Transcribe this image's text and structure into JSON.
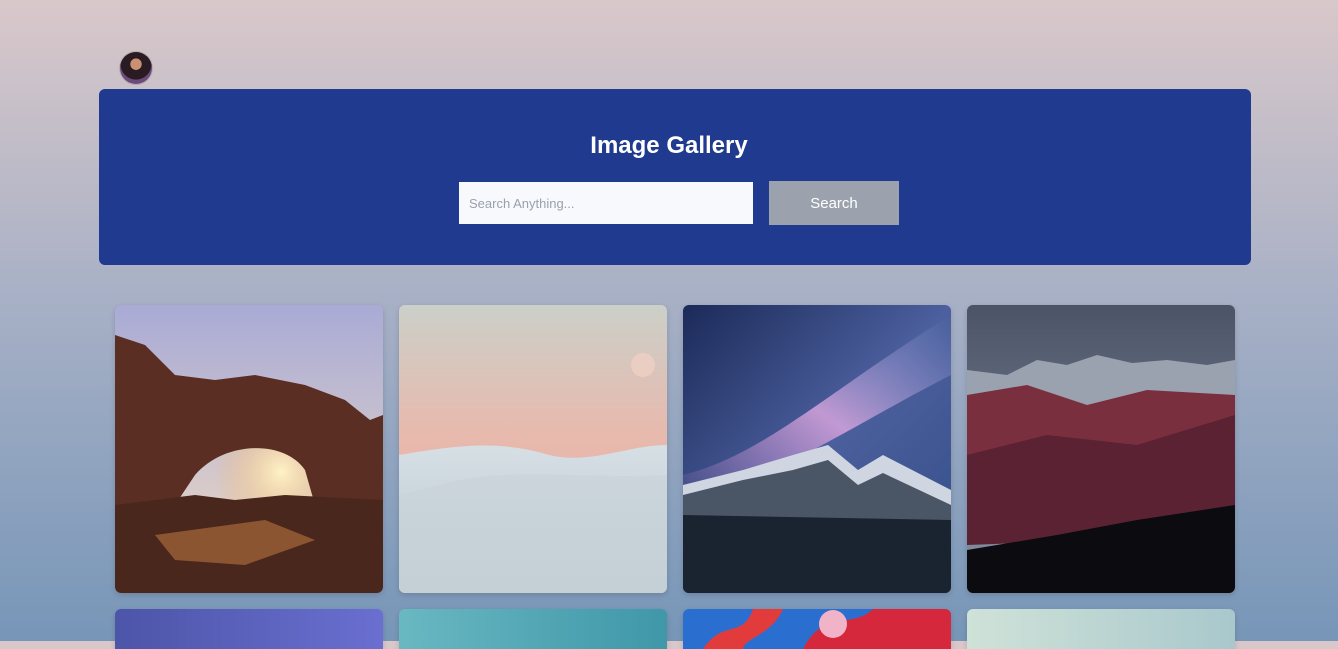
{
  "header": {
    "title": "Image Gallery",
    "search_placeholder": "Search Anything...",
    "search_button_label": "Search",
    "background_color": "#1f3a8e"
  },
  "gallery": {
    "images": [
      {
        "name": "desert-arch-image"
      },
      {
        "name": "pastel-dunes-image"
      },
      {
        "name": "milky-way-mountain-image"
      },
      {
        "name": "red-mountain-range-image"
      },
      {
        "name": "purple-gradient-image"
      },
      {
        "name": "teal-sky-image"
      },
      {
        "name": "colorful-ink-image"
      },
      {
        "name": "pale-beach-image"
      }
    ]
  }
}
